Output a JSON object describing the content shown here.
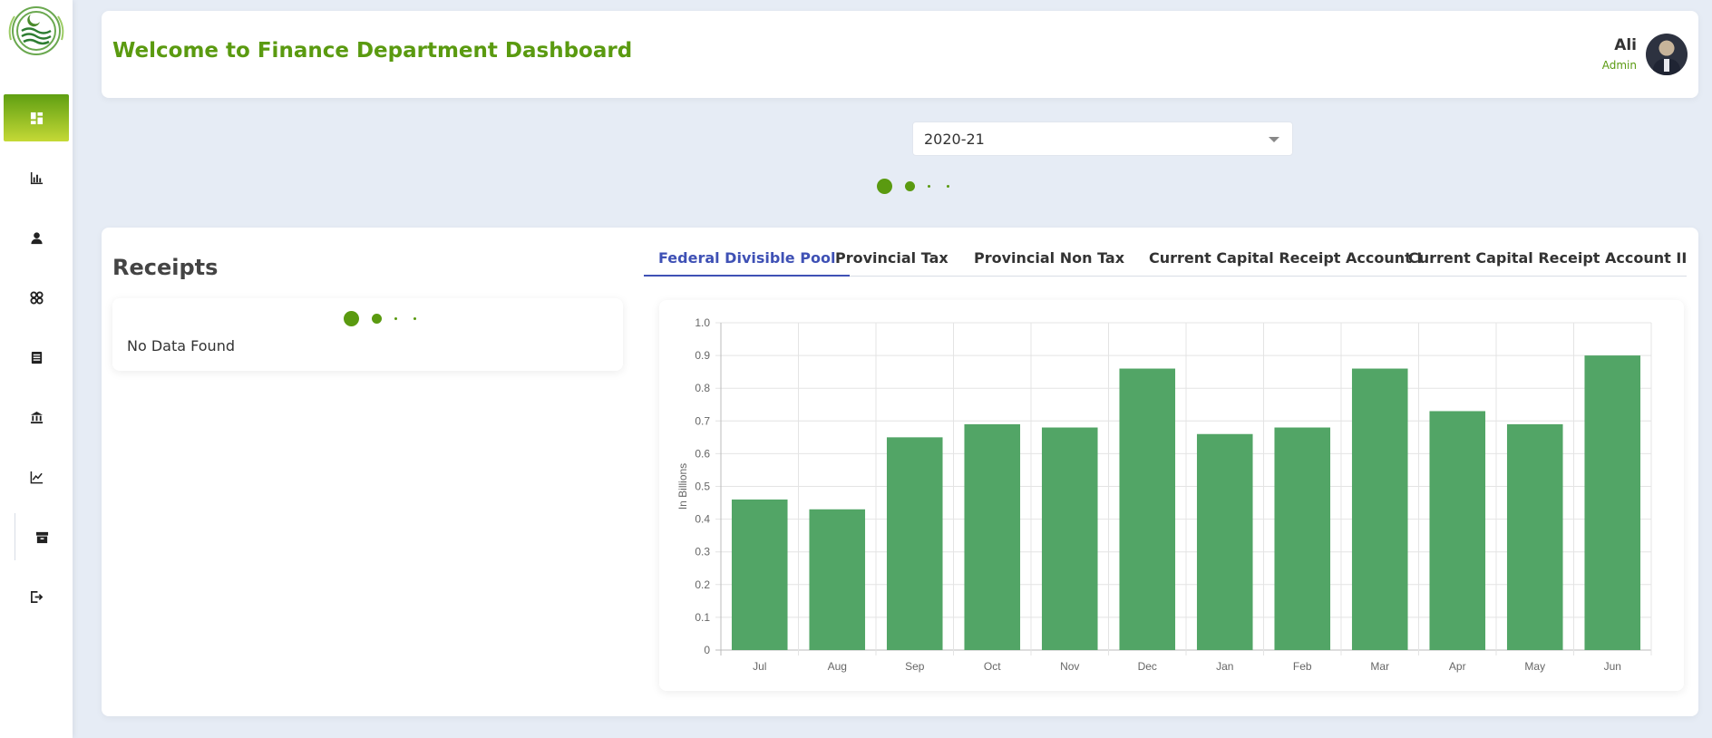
{
  "header": {
    "title": "Welcome to Finance Department Dashboard",
    "user_name": "Ali",
    "user_role": "Admin"
  },
  "sidebar": {
    "items": [
      {
        "icon": "dashboard-icon",
        "active": true
      },
      {
        "icon": "bar-chart-icon"
      },
      {
        "icon": "user-icon"
      },
      {
        "icon": "grid-icon"
      },
      {
        "icon": "document-icon"
      },
      {
        "icon": "bank-icon"
      },
      {
        "icon": "line-chart-icon"
      },
      {
        "icon": "archive-icon"
      },
      {
        "icon": "logout-icon"
      }
    ]
  },
  "filter": {
    "year": "2020-21"
  },
  "receipts": {
    "title": "Receipts",
    "empty_text": "No Data Found"
  },
  "tabs": [
    {
      "label": "Federal Divisible Pool",
      "active": true
    },
    {
      "label": "Provincial Tax"
    },
    {
      "label": "Provincial Non Tax"
    },
    {
      "label": "Current Capital Receipt Account I"
    },
    {
      "label": "Current Capital Receipt Account II"
    }
  ],
  "colors": {
    "accent": "#5a9a10",
    "bar": "#52a566",
    "tab_active": "#3f51b5"
  },
  "chart_data": {
    "type": "bar",
    "categories": [
      "Jul",
      "Aug",
      "Sep",
      "Oct",
      "Nov",
      "Dec",
      "Jan",
      "Feb",
      "Mar",
      "Apr",
      "May",
      "Jun"
    ],
    "values": [
      0.46,
      0.43,
      0.65,
      0.69,
      0.68,
      0.86,
      0.66,
      0.68,
      0.86,
      0.73,
      0.69,
      0.9
    ],
    "ylabel": "In Billions",
    "xlabel": "",
    "ylim": [
      0,
      1.0
    ],
    "yticks": [
      "0",
      "0.1",
      "0.2",
      "0.3",
      "0.4",
      "0.5",
      "0.6",
      "0.7",
      "0.8",
      "0.9",
      "1.0"
    ],
    "grid": true
  }
}
